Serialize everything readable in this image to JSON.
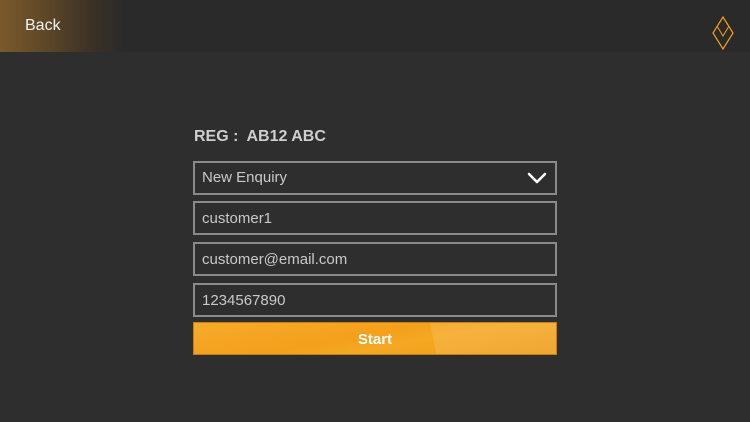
{
  "header": {
    "back_label": "Back"
  },
  "reg": {
    "label": "REG :",
    "value": "AB12 ABC"
  },
  "form": {
    "enquiry_type": "New Enquiry",
    "name": "customer1",
    "email": "customer@email.com",
    "phone": "1234567890",
    "start_label": "Start"
  },
  "icons": {
    "logo": "diamond-logo-icon",
    "dropdown": "chevron-down-icon"
  },
  "colors": {
    "accent": "#f3a01c",
    "background": "#2e2e2e",
    "field_border": "#8a8a8a",
    "text": "#c9c9c9"
  }
}
